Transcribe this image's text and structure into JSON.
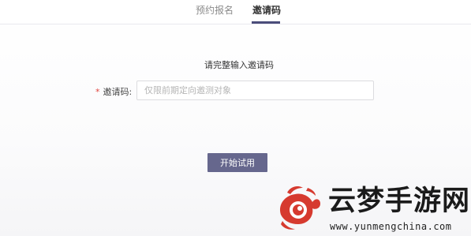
{
  "tabs": [
    {
      "label": "预约报名",
      "active": false
    },
    {
      "label": "邀请码",
      "active": true
    }
  ],
  "form": {
    "heading": "请完整输入邀请码",
    "required_mark": "*",
    "invite_label": "邀请码:",
    "invite_value": "",
    "invite_placeholder": "仅限前期定向邀测对象",
    "submit_label": "开始试用"
  },
  "watermark": {
    "title": "云梦手游网",
    "url": "www.yunmengchina.com",
    "logo_icon": "cloud-swirl-logo",
    "logo_color": "#d63a2f"
  },
  "colors": {
    "accent": "#4b4d7a",
    "button": "#66678d",
    "required": "#e0443d"
  }
}
